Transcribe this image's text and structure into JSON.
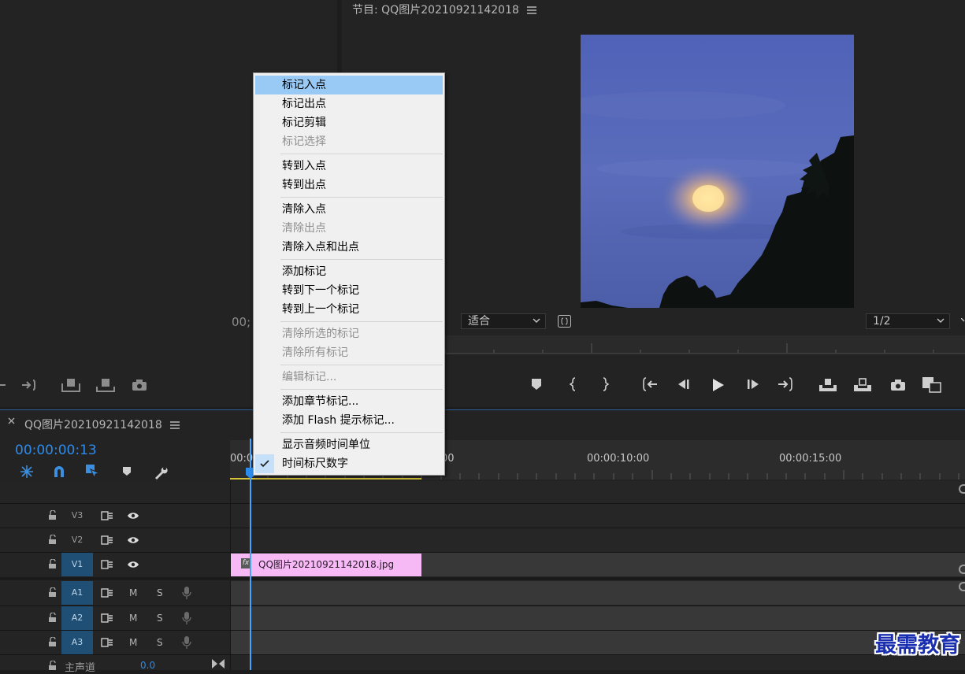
{
  "colors": {
    "accent": "#2d8ceb",
    "menu_highlight": "#99c9f5",
    "clip_pink": "#f6b9f5",
    "track_active": "#1f4f75",
    "playhead": "#4aa3ff",
    "watermark": "#1a2fb0"
  },
  "source": {
    "timecode_fragment": "00;"
  },
  "program": {
    "title": "节目: QQ图片20210921142018",
    "fit_select": "适合",
    "resolution_select": "1/2",
    "menu_icon": "hamburger-icon"
  },
  "timeline": {
    "tab_title": "QQ图片20210921142018",
    "timecode": "00:00:00:13",
    "ruler": {
      "label_start": "00:0",
      "label_5": "00",
      "label_10": "00:00:10:00",
      "label_15": "00:00:15:00"
    },
    "tracks": {
      "v3": "V3",
      "v2": "V2",
      "v1": "V1",
      "a1": "A1",
      "a2": "A2",
      "a3": "A3",
      "mute": "M",
      "solo": "S",
      "master_label": "主声道",
      "master_value": "0.0"
    },
    "clip": {
      "fx": "fx",
      "name": "QQ图片20210921142018.jpg"
    }
  },
  "context_menu": {
    "items": [
      {
        "label": "标记入点",
        "enabled": true,
        "highlighted": true
      },
      {
        "label": "标记出点",
        "enabled": true
      },
      {
        "label": "标记剪辑",
        "enabled": true
      },
      {
        "label": "标记选择",
        "enabled": false
      },
      {
        "label": "转到入点",
        "enabled": true
      },
      {
        "label": "转到出点",
        "enabled": true
      },
      {
        "label": "清除入点",
        "enabled": true
      },
      {
        "label": "清除出点",
        "enabled": false
      },
      {
        "label": "清除入点和出点",
        "enabled": true
      },
      {
        "label": "添加标记",
        "enabled": true
      },
      {
        "label": "转到下一个标记",
        "enabled": true
      },
      {
        "label": "转到上一个标记",
        "enabled": true
      },
      {
        "label": "清除所选的标记",
        "enabled": false
      },
      {
        "label": "清除所有标记",
        "enabled": false
      },
      {
        "label": "编辑标记...",
        "enabled": false
      },
      {
        "label": "添加章节标记...",
        "enabled": true
      },
      {
        "label": "添加 Flash 提示标记...",
        "enabled": true
      },
      {
        "label": "显示音频时间单位",
        "enabled": true
      },
      {
        "label": "时间标尺数字",
        "enabled": true,
        "checked": true
      }
    ]
  },
  "watermark": "最需教育"
}
